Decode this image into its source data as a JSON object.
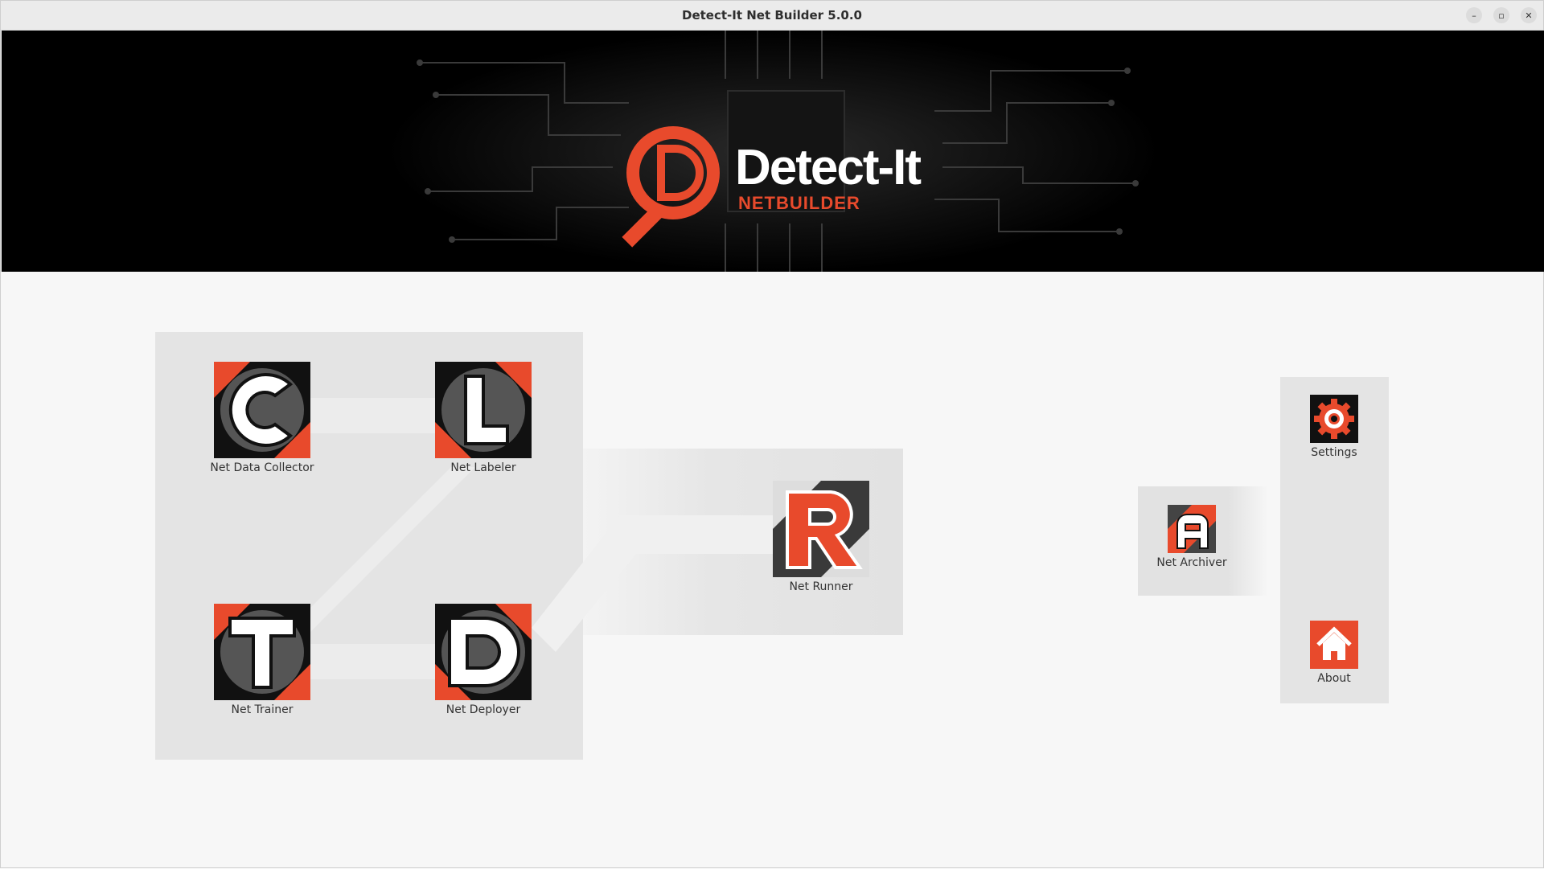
{
  "window": {
    "title": "Detect-It Net Builder 5.0.0",
    "controls": {
      "minimize": "–",
      "maximize": "▫",
      "close": "✕"
    }
  },
  "banner": {
    "brand": "Detect-It",
    "subtitle": "NETBUILDER"
  },
  "apps": {
    "collector": {
      "label": "Net Data Collector",
      "letter": "C",
      "icon": "collector-icon"
    },
    "labeler": {
      "label": "Net Labeler",
      "letter": "L",
      "icon": "labeler-icon"
    },
    "trainer": {
      "label": "Net Trainer",
      "letter": "T",
      "icon": "trainer-icon"
    },
    "deployer": {
      "label": "Net Deployer",
      "letter": "D",
      "icon": "deployer-icon"
    },
    "runner": {
      "label": "Net Runner",
      "letter": "R",
      "icon": "runner-icon"
    },
    "archiver": {
      "label": "Net Archiver",
      "letter": "A",
      "icon": "archiver-icon"
    },
    "settings": {
      "label": "Settings",
      "icon": "gear-icon"
    },
    "about": {
      "label": "About",
      "icon": "home-icon"
    }
  },
  "colors": {
    "accent": "#e84a2c",
    "icon_dark": "#111111",
    "panel": "#e4e4e4"
  }
}
